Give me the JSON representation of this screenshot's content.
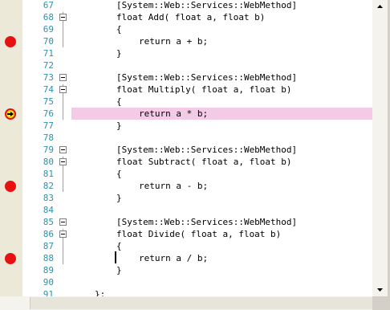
{
  "lines": [
    {
      "num": "67",
      "code": "        [System::Web::Services::WebMethod]",
      "bp": false
    },
    {
      "num": "68",
      "code": "        float Add( float a, float b)",
      "bp": false,
      "fold": true
    },
    {
      "num": "69",
      "code": "        {",
      "bp": false
    },
    {
      "num": "70",
      "code": "            return a + b;",
      "bp": true
    },
    {
      "num": "71",
      "code": "        }",
      "bp": false
    },
    {
      "num": "72",
      "code": "",
      "bp": false
    },
    {
      "num": "73",
      "code": "        [System::Web::Services::WebMethod]",
      "bp": false,
      "fold": true
    },
    {
      "num": "74",
      "code": "        float Multiply( float a, float b)",
      "bp": false,
      "fold": true
    },
    {
      "num": "75",
      "code": "        {",
      "bp": false
    },
    {
      "num": "76",
      "code": "            return a * b;",
      "bp": false,
      "current": true
    },
    {
      "num": "77",
      "code": "        }",
      "bp": false
    },
    {
      "num": "78",
      "code": "",
      "bp": false
    },
    {
      "num": "79",
      "code": "        [System::Web::Services::WebMethod]",
      "bp": false,
      "fold": true
    },
    {
      "num": "80",
      "code": "        float Subtract( float a, float b)",
      "bp": false,
      "fold": true
    },
    {
      "num": "81",
      "code": "        {",
      "bp": false
    },
    {
      "num": "82",
      "code": "            return a - b;",
      "bp": true
    },
    {
      "num": "83",
      "code": "        }",
      "bp": false
    },
    {
      "num": "84",
      "code": "",
      "bp": false
    },
    {
      "num": "85",
      "code": "        [System::Web::Services::WebMethod]",
      "bp": false,
      "fold": true
    },
    {
      "num": "86",
      "code": "        float Divide( float a, float b)",
      "bp": false,
      "fold": true
    },
    {
      "num": "87",
      "code": "        {",
      "bp": false
    },
    {
      "num": "88",
      "code": "            return a / b;",
      "bp": true
    },
    {
      "num": "89",
      "code": "        }",
      "bp": false
    },
    {
      "num": "90",
      "code": "",
      "bp": false
    },
    {
      "num": "91",
      "code": "    };",
      "bp": false
    }
  ],
  "colors": {
    "breakpoint": "#e81111",
    "current_line": "#f4cbe6",
    "line_number": "#2b91af",
    "gutter": "#ece9d8"
  },
  "icons": {
    "breakpoint": "breakpoint-icon",
    "current_statement": "current-statement-arrow-icon"
  }
}
